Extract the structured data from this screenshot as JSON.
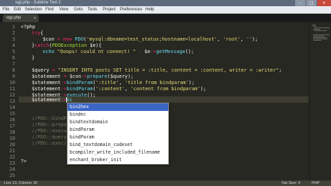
{
  "window": {
    "title": "sqp.php - Sublime Text 2"
  },
  "menu": [
    "File",
    "Edit",
    "Selection",
    "Find",
    "View",
    "Goto",
    "Tools",
    "Project",
    "Preferences",
    "Help"
  ],
  "tab": {
    "label": "sqp.php",
    "close": "×"
  },
  "line_numbers": [
    "1",
    "2",
    "3",
    "4",
    "5",
    "6",
    "7",
    "8",
    "9",
    "10",
    "11",
    "12",
    "13",
    "14",
    "15",
    "16",
    "17",
    "18",
    "19",
    "20",
    "21",
    "22",
    "23",
    "24",
    "25"
  ],
  "code": {
    "l1": "<?php",
    "l2a": "try",
    "l2b": "{",
    "l3a": "$con",
    "l3b": " = ",
    "l3c": "new",
    "l3d": " PDO",
    "l3e": "(",
    "l3f": "'mysql:dbname=test_status;hostname=localhost'",
    "l3g": ", ",
    "l3h": "'root'",
    "l3i": ", ",
    "l3j": "''",
    "l3k": ");",
    "l4a": "}",
    "l4b": "catch",
    "l4c": "(",
    "l4d": "PDOException",
    "l4e": " $e",
    "l4f": "){",
    "l5a": "echo",
    "l5b": " \"Ooops! could nt connect! \"",
    "l5c": " . ",
    "l5d": "$e",
    "l5e": "->",
    "l5f": "getMessage",
    "l5g": "();",
    "l6": "}",
    "l8a": "$query",
    "l8b": " = ",
    "l8c": "\"INSERT INTO posts SET title = :title, content = :content, writer = :writer\"",
    "l8d": ";",
    "l9a": "$statement",
    "l9b": " = ",
    "l9c": "$con",
    "l9d": "->",
    "l9e": "prepare",
    "l9f": "($query);",
    "l10a": "$statement",
    "l10b": "->",
    "l10c": "bindParam",
    "l10d": "(",
    "l10e": "':title'",
    "l10f": ", ",
    "l10g": "'title from bindparam'",
    "l10h": ");",
    "l11a": "$statement",
    "l11b": "->",
    "l11c": "bindParam",
    "l11d": "(",
    "l11e": "':content'",
    "l11f": ", ",
    "l11g": "'content from bindparam'",
    "l11h": ");",
    "l12a": "$statement",
    "l12b": "->",
    "l12c": "execute",
    "l12d": "();",
    "l13a": "$statement",
    "l13b": "->",
    "l13c": "bi",
    "l16": "//PDO::bindParam",
    "l17": "//PDO::prepare",
    "l18": "//PDO::execute",
    "l19": "//PDO::query",
    "l20": "//PDO::exec()",
    "l25": "?>"
  },
  "autocomplete": [
    "bin2hex",
    "bindec",
    "bindtextdomain",
    "bindParam",
    "bindParam",
    "bind_textdomain_codeset",
    "bcompiler_write_included_filename",
    "enchant_broker_init"
  ],
  "status": {
    "left": "Line 13, Column 18",
    "tab_size": "Tab Size: 4",
    "syntax": "PHP"
  }
}
